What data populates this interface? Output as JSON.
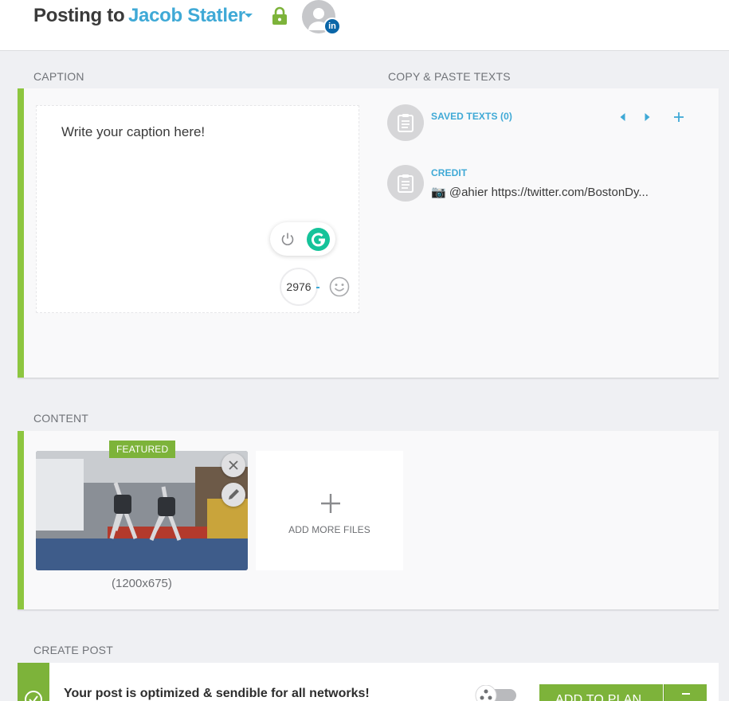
{
  "header": {
    "posting_label": "Posting to",
    "account_name": "Jacob Statler",
    "network_badge": "in"
  },
  "caption": {
    "section_label": "CAPTION",
    "placeholder": "Write your caption here!",
    "char_count": "2976"
  },
  "copy_paste": {
    "section_label": "COPY & PASTE TEXTS",
    "saved_texts_label": "SAVED TEXTS (0)",
    "credit_label": "CREDIT",
    "credit_text": "📷 @ahier https://twitter.com/BostonDy..."
  },
  "content": {
    "section_label": "CONTENT",
    "featured_badge": "FEATURED",
    "dimensions": "(1200x675)",
    "add_more_label": "ADD MORE FILES"
  },
  "create_post": {
    "section_label": "CREATE POST",
    "status_text": "Your post is optimized & sendible for all networks!",
    "add_to_plan_label": "ADD TO PLAN"
  },
  "colors": {
    "accent_green": "#8dc63f",
    "link_blue": "#3fa9d6",
    "grammarly_green": "#15c39a",
    "linkedin_blue": "#0a66a8"
  },
  "icons": [
    "lock-icon",
    "avatar-icon",
    "linkedin-icon",
    "power-icon",
    "grammarly-icon",
    "emoji-icon",
    "clipboard-icon",
    "chevron-left-icon",
    "chevron-right-icon",
    "plus-icon",
    "close-icon",
    "pencil-icon",
    "check-icon",
    "recycle-icon",
    "chevron-down-icon"
  ]
}
